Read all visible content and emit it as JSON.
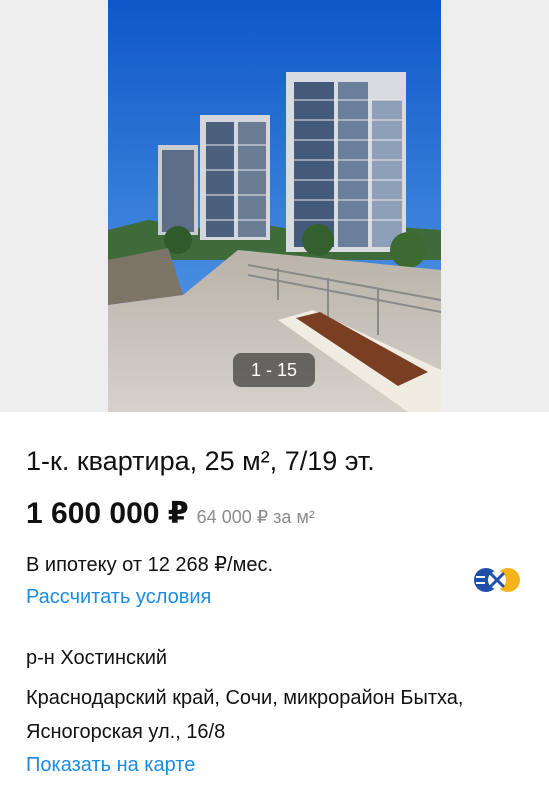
{
  "gallery": {
    "counter": "1 - 15"
  },
  "listing": {
    "title": "1-к. квартира, 25 м², 7/19 эт.",
    "price": "1 600 000 ₽",
    "price_per_m": "64 000 ₽ за м²"
  },
  "mortgage": {
    "text": "В ипотеку от 12 268 ₽/мес.",
    "calc_link": "Рассчитать условия",
    "bank_logo_icon": "bank-logo-icon"
  },
  "location": {
    "district": "р-н Хостинский",
    "address": "Краснодарский край, Сочи, микрорайон Бытха, Ясногорская ул., 16/8",
    "map_link": "Показать на карте"
  },
  "colors": {
    "link": "#1a8ce6",
    "text": "#111111",
    "muted": "#8c8c8c",
    "gallery_bg": "#eeeeee"
  }
}
